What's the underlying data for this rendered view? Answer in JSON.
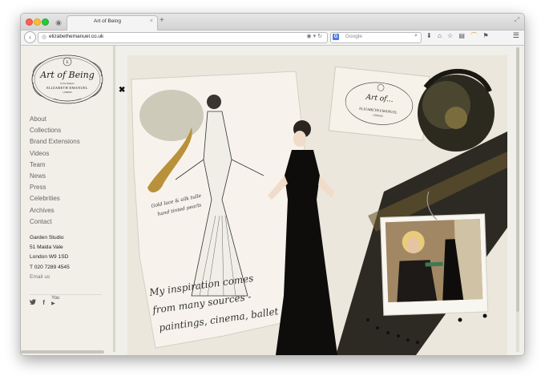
{
  "browser": {
    "tab_title": "Art of Being",
    "tab_close": "×",
    "new_tab": "+",
    "url": "elizabethemanuel.co.uk",
    "search_engine_badge": "G",
    "search_placeholder": "Google",
    "icons": [
      "back-arrow-icon",
      "globe-icon",
      "reader-icon",
      "reload-icon",
      "search-icon",
      "download-icon",
      "home-icon",
      "bookmark-star-icon",
      "clipboard-icon",
      "rainbow-icon",
      "extension-icon",
      "menu-icon"
    ]
  },
  "logo": {
    "script_title": "Art of Being",
    "tagline": "by the designer",
    "name": "ELIZABETH EMANUEL",
    "city": "LONDON"
  },
  "nav": {
    "items": [
      "About",
      "Collections",
      "Brand Extensions",
      "Videos",
      "Team",
      "News",
      "Press",
      "Celebrities",
      "Archives",
      "Contact"
    ]
  },
  "address": {
    "line1": "Garden Studio",
    "line2": "51 Maida Vale",
    "line3": "London W9 1SD",
    "phone": "T 020 7289 4545",
    "email_label": "Email us"
  },
  "social": [
    "twitter-icon",
    "facebook-icon",
    "youtube-icon"
  ],
  "collage": {
    "close_symbol": "✖",
    "sketch_note": "Gold lace & silk tulle hand tinted pearls",
    "handwriting": "My inspiration comes from many sources - paintings, cinema, ballet",
    "card_title": "Art of...",
    "card_name": "ELIZABETH EMANUEL",
    "card_city": "LONDON"
  },
  "colors": {
    "page_bg": "#f1efea",
    "text_nav": "#666666",
    "text_dark": "#222222",
    "accent_gold": "#b9913a"
  }
}
